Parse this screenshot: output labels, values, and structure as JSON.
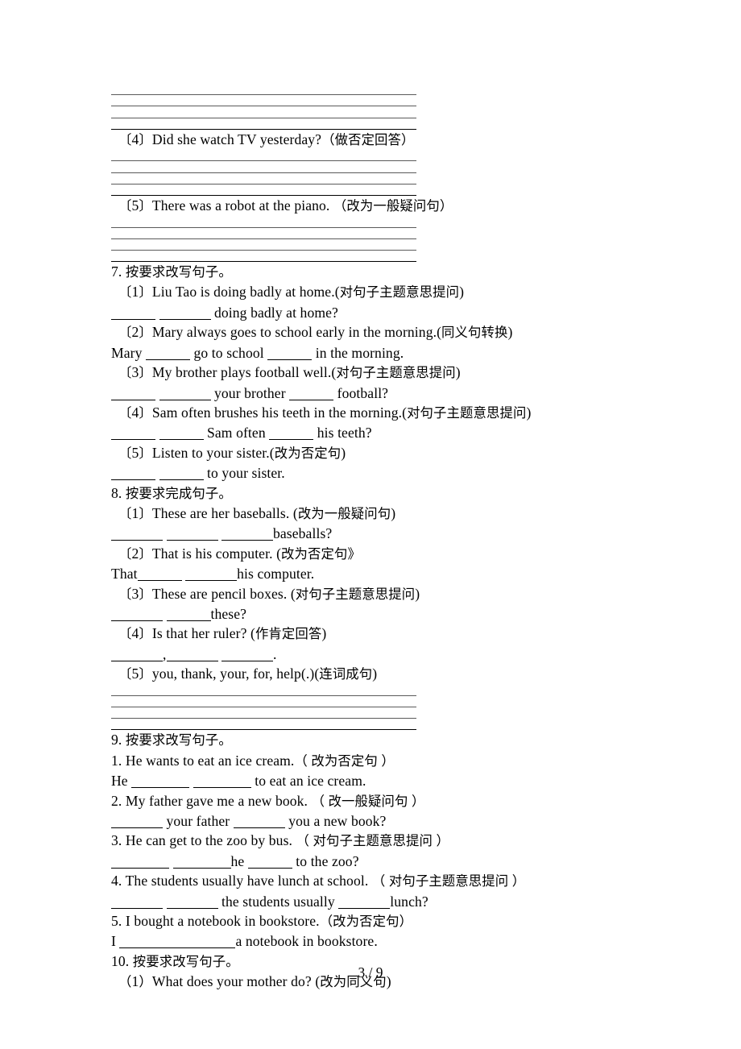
{
  "page": {
    "footer_page_number": "3 / 9",
    "paper_width": 920,
    "paper_height": 1302,
    "ink_color": "#000000",
    "rule_color": "#5a5a5a"
  },
  "top_rules": {
    "count": 4,
    "thick_last": true
  },
  "carryover": {
    "item4": {
      "label": "〔4〕",
      "text": "Did she watch TV yesterday?",
      "instruction": "（做否定回答）",
      "rules": {
        "count": 4,
        "thick_last": true
      }
    },
    "item5": {
      "label": "〔5〕",
      "text": "There was a robot at the piano.",
      "instruction": "（改为一般疑问句）",
      "rules": {
        "count": 4,
        "thick_last": true
      }
    }
  },
  "sections": [
    {
      "number": "7.",
      "title": "按要求改写句子。",
      "items": [
        {
          "label": "〔1〕",
          "prompt": "Liu Tao is doing badly at home.",
          "instruction": "(对句子主题意思提问)",
          "answer_prefix": "",
          "answer_blanks": [
            "b6",
            "b7"
          ],
          "answer_suffix": " doing badly at home?"
        },
        {
          "label": "〔2〕",
          "prompt": "Mary always goes to school early in the morning.",
          "instruction": "(同义句转换)",
          "answer_prefix": "Mary ",
          "answer_blanks": [
            "b6"
          ],
          "answer_mid": " go to school ",
          "answer_blanks2": [
            "b6"
          ],
          "answer_suffix": " in the morning."
        },
        {
          "label": "〔3〕",
          "prompt": "My brother plays football well.",
          "instruction": "(对句子主题意思提问)",
          "answer_prefix": "",
          "answer_blanks": [
            "b6",
            "b7"
          ],
          "answer_mid": " your brother ",
          "answer_blanks2": [
            "b6"
          ],
          "answer_suffix": " football?"
        },
        {
          "label": "〔4〕",
          "prompt": "Sam often brushes his teeth in the morning.",
          "instruction": "(对句子主题意思提问)",
          "answer_prefix": "",
          "answer_blanks": [
            "b6",
            "b6"
          ],
          "answer_mid": " Sam often ",
          "answer_blanks2": [
            "b6"
          ],
          "answer_suffix": " his teeth?"
        },
        {
          "label": "〔5〕",
          "prompt": "Listen to your sister.",
          "instruction": "(改为否定句)",
          "answer_prefix": "",
          "answer_blanks": [
            "b6",
            "b6"
          ],
          "answer_suffix": " to your sister."
        }
      ]
    },
    {
      "number": "8.",
      "title": "按要求完成句子。",
      "items": [
        {
          "label": "〔1〕",
          "prompt": "These are her baseballs.",
          "instruction": "(改为一般疑问句)",
          "answer_blanks": [
            "b7",
            "b7",
            "b7"
          ],
          "answer_suffix": "baseballs?"
        },
        {
          "label": "〔2〕",
          "prompt": "That is his computer.",
          "instruction": "(改为否定句》",
          "answer_prefix": "That",
          "answer_blanks": [
            "b6",
            "b7"
          ],
          "answer_suffix": "his computer."
        },
        {
          "label": "〔3〕",
          "prompt": "These are pencil boxes.",
          "instruction": "(对句子主题意思提问)",
          "answer_blanks": [
            "b7",
            "b6"
          ],
          "answer_suffix": "these?"
        },
        {
          "label": "〔4〕",
          "prompt": "Is that her ruler?",
          "instruction": "(作肯定回答)",
          "answer_blanks": [
            "b7",
            "b7",
            "b7"
          ],
          "answer_pattern": "blank,blank blank."
        },
        {
          "label": "〔5〕",
          "prompt": "you, thank, your, for, help(.)",
          "instruction": "(连词成句)",
          "rules": {
            "count": 4,
            "thick_last": true
          }
        }
      ]
    },
    {
      "number": "9.",
      "title": "按要求改写句子。",
      "items": [
        {
          "label": "1.",
          "prompt": "He wants to eat an ice cream.",
          "instruction": "（ 改为否定句 ）",
          "answer_prefix": "He ",
          "answer_blanks": [
            "b8",
            "b8"
          ],
          "answer_suffix": " to eat an ice cream."
        },
        {
          "label": "2.",
          "prompt": "My father gave me a new book.",
          "instruction": "（ 改一般疑问句 ）",
          "answer_blanks": [
            "b7"
          ],
          "answer_mid": " your father ",
          "answer_blanks2": [
            "b7"
          ],
          "answer_suffix": " you a new book?"
        },
        {
          "label": "3.",
          "prompt": "He can get to the zoo by bus.",
          "instruction": "（ 对句子主题意思提问 ）",
          "answer_blanks": [
            "b8",
            "b8"
          ],
          "answer_mid": "he ",
          "answer_blanks2": [
            "b6"
          ],
          "answer_suffix": " to the zoo?"
        },
        {
          "label": "4.",
          "prompt": "The students usually have lunch at school.",
          "instruction": "（ 对句子主题意思提问 ）",
          "answer_blanks": [
            "b7",
            "b7"
          ],
          "answer_mid": " the students usually ",
          "answer_blanks2": [
            "b7"
          ],
          "answer_suffix": "lunch?"
        },
        {
          "label": "5.",
          "prompt": "I bought a notebook in bookstore.",
          "instruction": "（改为否定句）",
          "answer_prefix": "I ",
          "answer_blanks": [
            "b8",
            "b8"
          ],
          "answer_suffix": "a notebook in bookstore."
        }
      ]
    },
    {
      "number": "10.",
      "title": "按要求改写句子。",
      "items": [
        {
          "label": "（1）",
          "prompt": "What does your mother do?",
          "instruction": "(改为同义句)"
        }
      ]
    }
  ],
  "lines": [
    {
      "kind": "rules",
      "count": 4
    },
    {
      "kind": "text",
      "style": "q",
      "text": "〔4〕Did she watch TV yesterday?（做否定回答）"
    },
    {
      "kind": "rules",
      "count": 4
    },
    {
      "kind": "text",
      "style": "q",
      "text": "〔5〕There was a robot at the piano. （改为一般疑问句）"
    },
    {
      "kind": "rules",
      "count": 4
    },
    {
      "kind": "text",
      "style": "h",
      "text": "7. 按要求改写句子。"
    },
    {
      "kind": "text",
      "style": "q",
      "text": "〔1〕Liu Tao is doing badly at home.(对句子主题意思提问)"
    },
    {
      "kind": "blankline",
      "style": "a",
      "parts": [
        "B6",
        " ",
        "B7",
        " doing badly at home?"
      ]
    },
    {
      "kind": "text",
      "style": "q",
      "text": "〔2〕Mary always goes to school early in the morning.(同义句转换)"
    },
    {
      "kind": "blankline",
      "style": "a",
      "parts": [
        "Mary ",
        "B6",
        " go to school ",
        "B6",
        " in the morning."
      ]
    },
    {
      "kind": "text",
      "style": "q",
      "text": "〔3〕My brother plays football well.(对句子主题意思提问)"
    },
    {
      "kind": "blankline",
      "style": "a",
      "parts": [
        "B6",
        " ",
        "B7",
        " your brother ",
        "B6",
        " football?"
      ]
    },
    {
      "kind": "text",
      "style": "q",
      "text": "〔4〕Sam often brushes his teeth in the morning.(对句子主题意思提问)"
    },
    {
      "kind": "blankline",
      "style": "a",
      "parts": [
        "B6",
        " ",
        "B6",
        " Sam often ",
        "B6",
        " his teeth?"
      ]
    },
    {
      "kind": "text",
      "style": "q",
      "text": "〔5〕Listen to your sister.(改为否定句)"
    },
    {
      "kind": "blankline",
      "style": "a",
      "parts": [
        "B6",
        " ",
        "B6",
        " to your sister."
      ]
    },
    {
      "kind": "text",
      "style": "h",
      "text": "8. 按要求完成句子。"
    },
    {
      "kind": "text",
      "style": "q",
      "text": "〔1〕These are her baseballs. (改为一般疑问句)"
    },
    {
      "kind": "blankline",
      "style": "a",
      "parts": [
        "B7",
        " ",
        "B7",
        " ",
        "B7",
        "baseballs?"
      ]
    },
    {
      "kind": "text",
      "style": "q",
      "text": "〔2〕That is his computer. (改为否定句》"
    },
    {
      "kind": "blankline",
      "style": "a",
      "parts": [
        "That",
        "B6",
        " ",
        "B7",
        "his computer."
      ]
    },
    {
      "kind": "text",
      "style": "q",
      "text": "〔3〕These are pencil boxes. (对句子主题意思提问)"
    },
    {
      "kind": "blankline",
      "style": "a",
      "parts": [
        "B7",
        " ",
        "B6",
        "these?"
      ]
    },
    {
      "kind": "text",
      "style": "q",
      "text": "〔4〕Is that her ruler? (作肯定回答)"
    },
    {
      "kind": "blankline",
      "style": "a",
      "parts": [
        "B7",
        ",",
        "B7",
        " ",
        "B7",
        "."
      ]
    },
    {
      "kind": "text",
      "style": "q",
      "text": "〔5〕you, thank, your, for, help(.)(连词成句)"
    },
    {
      "kind": "rules",
      "count": 4
    },
    {
      "kind": "text",
      "style": "h",
      "text": "9. 按要求改写句子。"
    },
    {
      "kind": "text",
      "style": "h",
      "text": "1. He wants to eat an ice cream.（ 改为否定句 ）"
    },
    {
      "kind": "blankline",
      "style": "a",
      "parts": [
        "He ",
        "B8",
        " ",
        "B8",
        " to eat an ice cream."
      ]
    },
    {
      "kind": "text",
      "style": "h",
      "text": "2. My father gave me a new book. （ 改一般疑问句 ）"
    },
    {
      "kind": "blankline",
      "style": "a",
      "parts": [
        "B7",
        " your father ",
        "B7",
        " you a new book?"
      ]
    },
    {
      "kind": "text",
      "style": "h",
      "text": "3. He can get to the zoo by bus. （ 对句子主题意思提问 ）"
    },
    {
      "kind": "blankline",
      "style": "a",
      "parts": [
        "B8",
        " ",
        "B8",
        "he ",
        "B6",
        " to the zoo?"
      ]
    },
    {
      "kind": "text",
      "style": "h",
      "text": "4. The students usually have lunch at school. （ 对句子主题意思提问 ）"
    },
    {
      "kind": "blankline",
      "style": "a",
      "parts": [
        "B7",
        " ",
        "B7",
        " the students usually ",
        "B7",
        "lunch?"
      ]
    },
    {
      "kind": "text",
      "style": "h",
      "text": "5. I bought a notebook in bookstore.（改为否定句）"
    },
    {
      "kind": "blankline",
      "style": "a",
      "parts": [
        "I ",
        "B8",
        "B8",
        "a notebook in bookstore."
      ]
    },
    {
      "kind": "text",
      "style": "h",
      "text": "10. 按要求改写句子。"
    },
    {
      "kind": "text",
      "style": "q",
      "text": "（1）What does your mother do? (改为同义句)"
    }
  ]
}
